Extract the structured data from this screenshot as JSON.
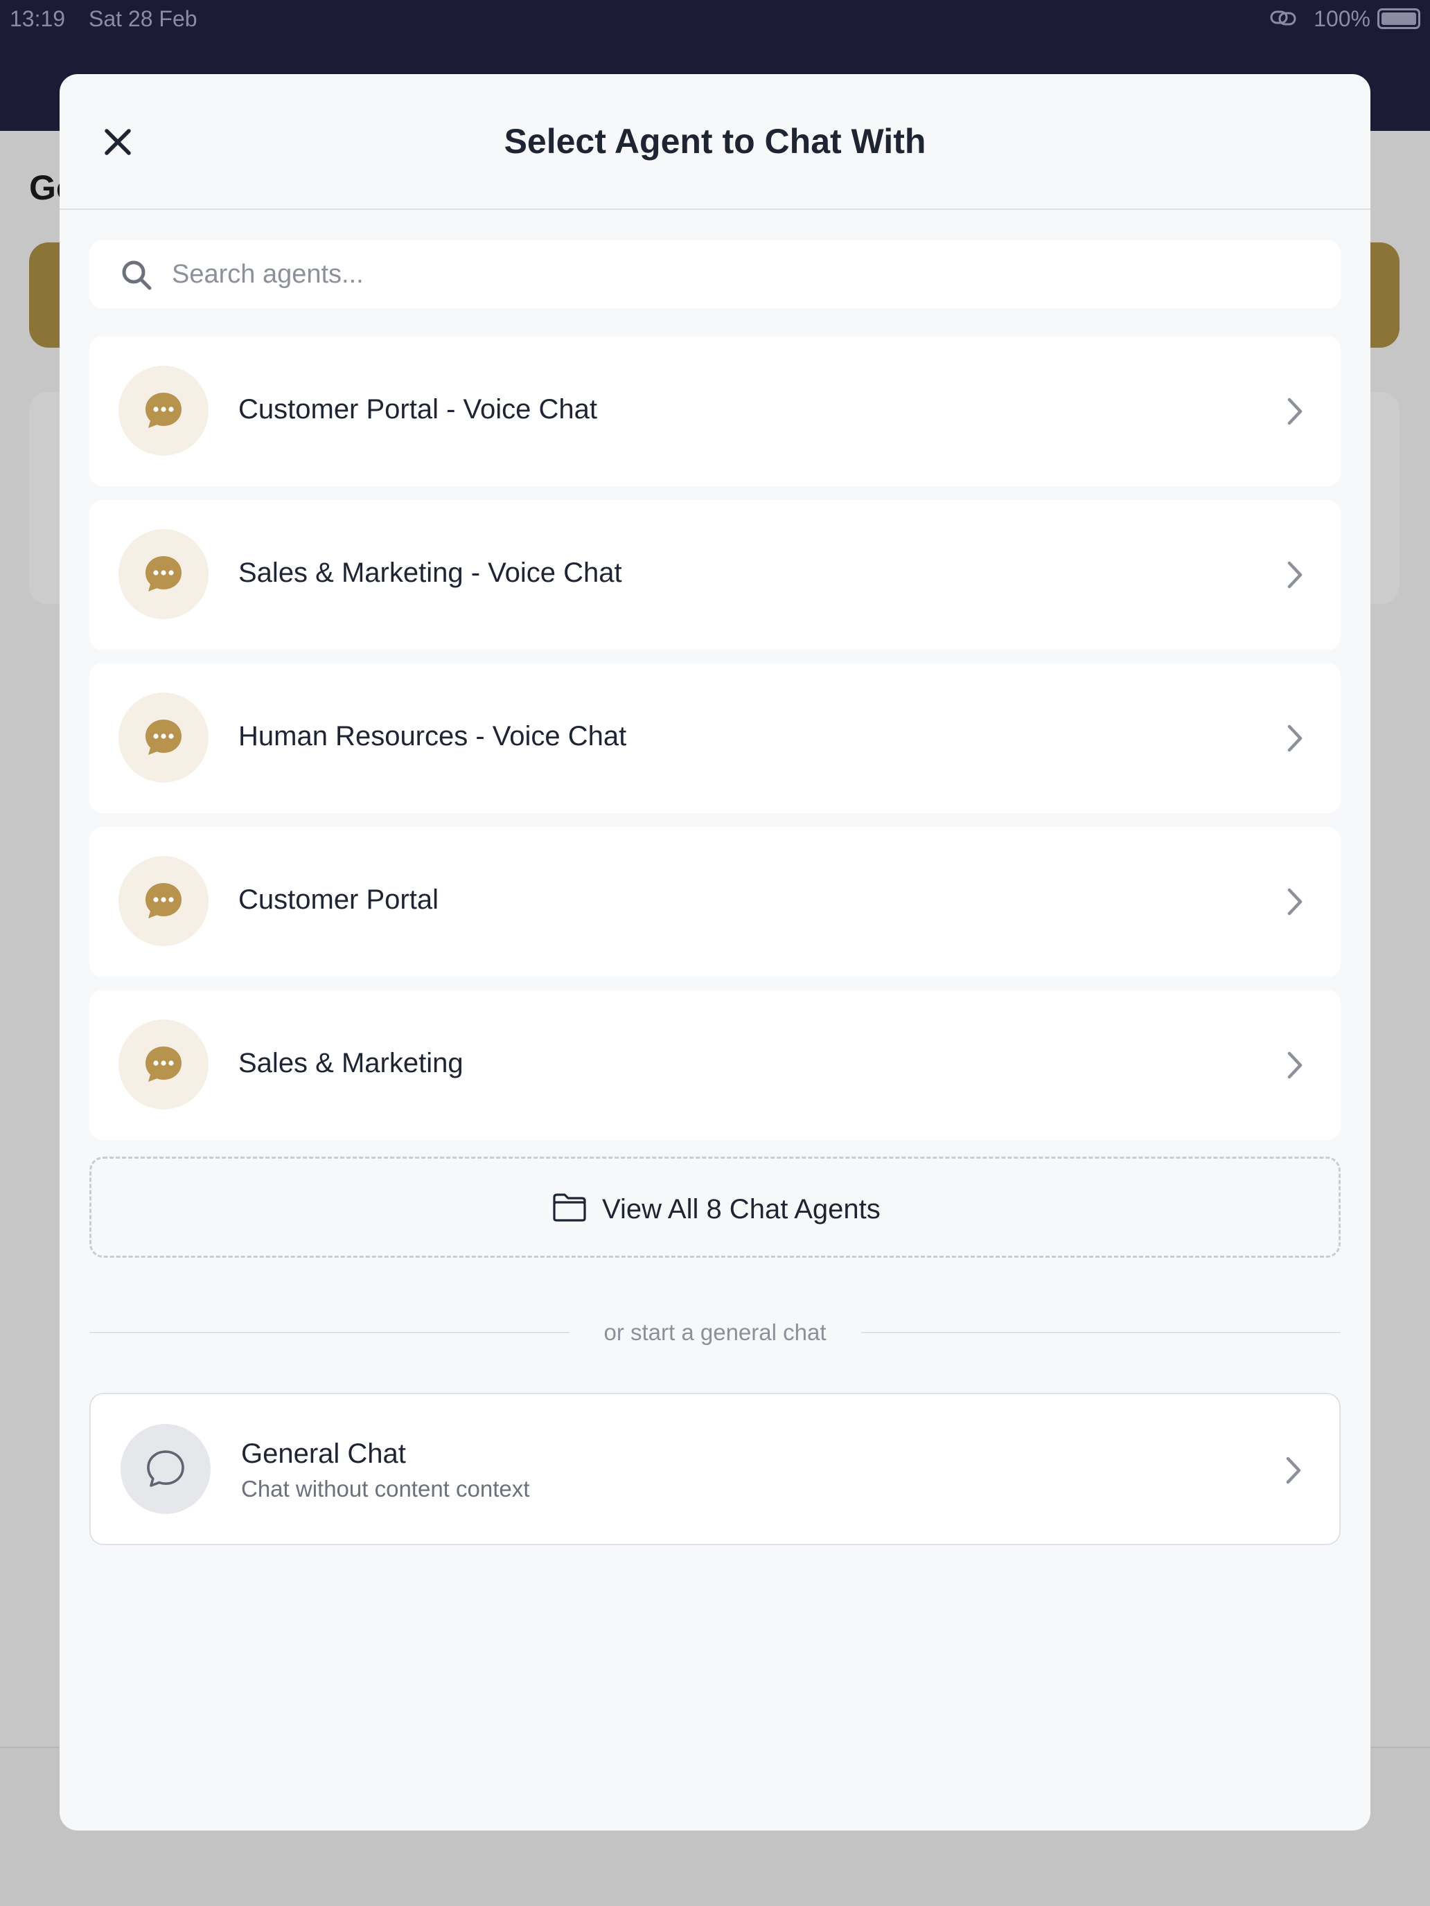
{
  "status_bar": {
    "time": "13:19",
    "date": "Sat 28 Feb",
    "battery": "100%"
  },
  "background": {
    "heading": "Go"
  },
  "modal": {
    "title": "Select Agent to Chat With",
    "close_icon": "close-icon",
    "search": {
      "placeholder": "Search agents...",
      "value": "",
      "icon": "search-icon"
    },
    "agents": [
      {
        "name": "Customer Portal - Voice Chat",
        "icon": "chat-bubble-icon"
      },
      {
        "name": "Sales & Marketing - Voice Chat",
        "icon": "chat-bubble-icon"
      },
      {
        "name": "Human Resources - Voice Chat",
        "icon": "chat-bubble-icon"
      },
      {
        "name": "Customer Portal",
        "icon": "chat-bubble-icon"
      },
      {
        "name": "Sales & Marketing",
        "icon": "chat-bubble-icon"
      }
    ],
    "view_all": {
      "label": "View All 8 Chat Agents",
      "icon": "folder-icon"
    },
    "divider_text": "or start a general chat",
    "general_chat": {
      "title": "General Chat",
      "subtitle": "Chat without content context",
      "icon": "chat-outline-icon"
    }
  },
  "colors": {
    "accent_gold": "#b8934e",
    "header_dark": "#1d1a36",
    "modal_bg": "#f7f8fa",
    "text_primary": "#1f2433"
  }
}
